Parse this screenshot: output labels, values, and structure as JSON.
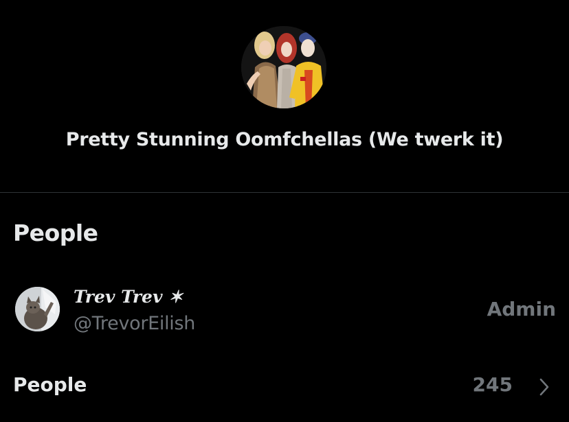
{
  "group": {
    "title": "Pretty Stunning Oomfchellas (We twerk it)"
  },
  "people_section": {
    "heading": "People"
  },
  "member": {
    "display_name": "Trev Trev ✶",
    "handle": "@TrevorEilish",
    "role": "Admin"
  },
  "people_row": {
    "label": "People",
    "count": "245"
  },
  "icons": {
    "chevron": "chevron-right-icon"
  },
  "colors": {
    "background": "#000000",
    "primary_text": "#e7e9ea",
    "secondary_text": "#71767b",
    "divider": "#2f3336"
  }
}
